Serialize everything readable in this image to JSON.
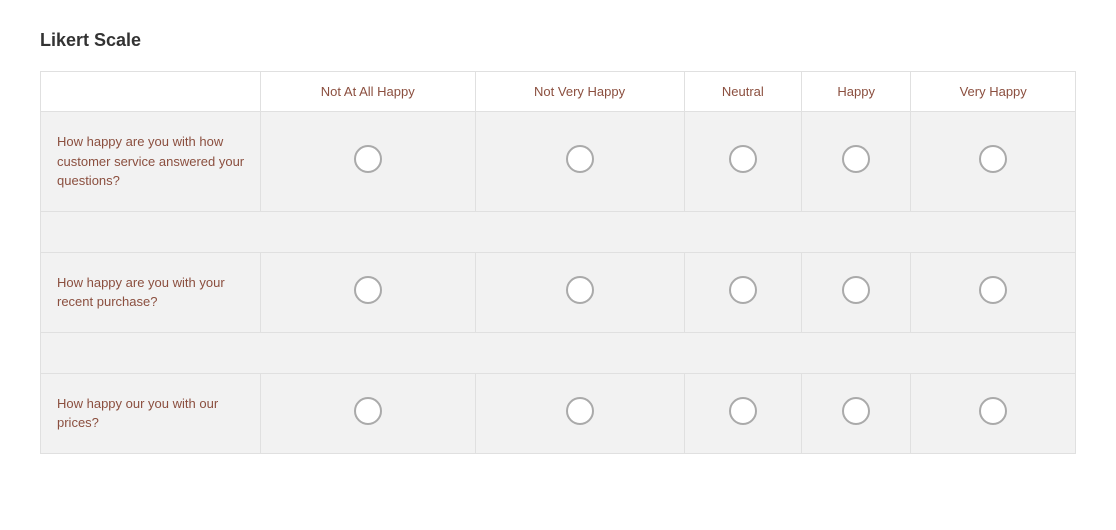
{
  "title": "Likert Scale",
  "columns": [
    {
      "id": "question",
      "label": ""
    },
    {
      "id": "not_at_all_happy",
      "label": "Not At All Happy"
    },
    {
      "id": "not_very_happy",
      "label": "Not Very Happy"
    },
    {
      "id": "neutral",
      "label": "Neutral"
    },
    {
      "id": "happy",
      "label": "Happy"
    },
    {
      "id": "very_happy",
      "label": "Very Happy"
    }
  ],
  "rows": [
    {
      "question": "How happy are you with how customer service answered your questions?",
      "name": "q1"
    },
    {
      "question": "How happy are you with your recent purchase?",
      "name": "q2"
    },
    {
      "question": "How happy our you with our prices?",
      "name": "q3"
    }
  ]
}
